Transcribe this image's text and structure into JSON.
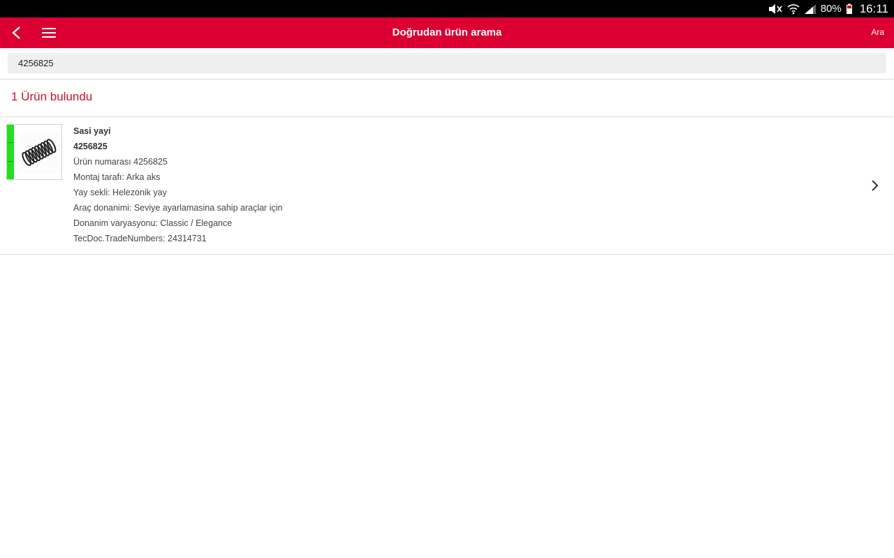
{
  "status_bar": {
    "battery": "80%",
    "time": "16:11",
    "icons": [
      "mute-icon",
      "wifi-icon",
      "signal-icon",
      "battery-icon"
    ]
  },
  "app_bar": {
    "title": "Doğrudan ürün arama",
    "search_action": "Ara",
    "icons": [
      "back-arrow-icon",
      "hamburger-menu-icon"
    ],
    "color": "#dc0032"
  },
  "search": {
    "value": "4256825"
  },
  "results": {
    "count_label": "1 Ürün bulundu",
    "items": [
      {
        "name": "Sasi yayi",
        "number": "4256825",
        "attributes": [
          "Ürün numarası 4256825",
          "Montaj tarafı: Arka aks",
          "Yay sekli: Helezonik yay",
          "Araç donanimi: Seviye ayarlamasina sahip araçlar için",
          "Donanim varyasyonu: Classic / Elegance",
          "TecDoc.TradeNumbers: 24314731"
        ],
        "availability_color": "#22e01e",
        "image_icon": "coil-spring-icon"
      }
    ]
  }
}
